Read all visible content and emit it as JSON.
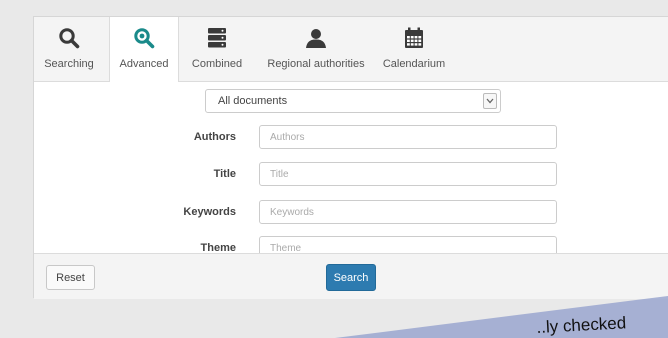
{
  "tabs": [
    {
      "label": "Searching",
      "icon": "search-icon"
    },
    {
      "label": "Advanced",
      "icon": "advanced-search-icon",
      "active": true
    },
    {
      "label": "Combined",
      "icon": "stack-icon"
    },
    {
      "label": "Regional authorities",
      "icon": "person-icon"
    },
    {
      "label": "Calendarium",
      "icon": "calendar-icon"
    }
  ],
  "document_select": {
    "selected": "All documents"
  },
  "fields": {
    "authors": {
      "label": "Authors",
      "placeholder": "Authors"
    },
    "title": {
      "label": "Title",
      "placeholder": "Title"
    },
    "keywords": {
      "label": "Keywords",
      "placeholder": "Keywords"
    },
    "theme": {
      "label": "Theme",
      "placeholder": "Theme"
    }
  },
  "buttons": {
    "reset": "Reset",
    "search": "Search"
  },
  "banner": {
    "text": "..ly checked"
  },
  "colors": {
    "accent": "#2d7bb0",
    "advanced_icon": "#1a8a8a",
    "icon_dark": "#3a3a3a"
  }
}
